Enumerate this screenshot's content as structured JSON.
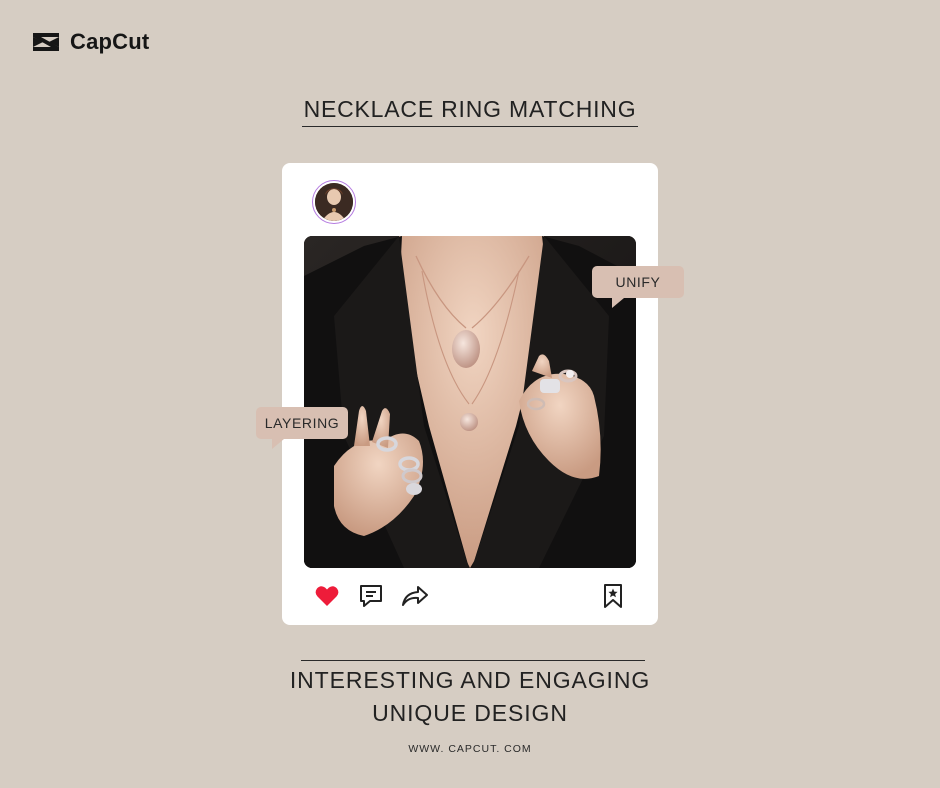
{
  "brand": {
    "name": "CapCut",
    "logo_icon": "capcut-logo-icon"
  },
  "header": {
    "title": "NECKLACE RING MATCHING"
  },
  "post": {
    "avatar_icon": "profile-avatar",
    "image_icon": "jewelry-photo",
    "actions": {
      "like_icon": "heart-icon",
      "like_color": "#ee1c3a",
      "comment_icon": "comment-icon",
      "share_icon": "share-icon",
      "save_icon": "bookmark-star-icon"
    }
  },
  "bubbles": {
    "unify": "UNIFY",
    "layering": "LAYERING",
    "color": "#d8bfb2"
  },
  "footer": {
    "line1": "INTERESTING AND ENGAGING",
    "line2": "UNIQUE DESIGN",
    "website": "WWW. CAPCUT. COM"
  },
  "colors": {
    "background": "#d6cdc3",
    "card": "#ffffff",
    "text": "#222222"
  }
}
